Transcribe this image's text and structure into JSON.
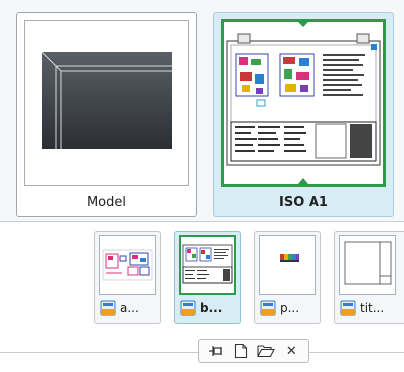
{
  "layouts": [
    {
      "label": "Model",
      "selected": false
    },
    {
      "label": "ISO A1",
      "selected": true
    }
  ],
  "sheets": [
    {
      "label": "a...",
      "icon": "sheet-icon",
      "active": false
    },
    {
      "label": "b...",
      "icon": "sheet-icon",
      "active": true
    },
    {
      "label": "p...",
      "icon": "sheet-icon",
      "active": false
    },
    {
      "label": "tit...",
      "icon": "sheet-icon",
      "active": false
    }
  ],
  "toolbar": {
    "buttons": [
      "pin-icon",
      "new-sheet-icon",
      "open-folder-icon",
      "close-icon"
    ],
    "close_glyph": "✕"
  },
  "colors": {
    "selection_fill": "#d7ecf5",
    "sheet_border_green": "#2e9a4c",
    "sheet_icon_blue": "#2b7fd4",
    "sheet_icon_orange": "#f0a020"
  }
}
